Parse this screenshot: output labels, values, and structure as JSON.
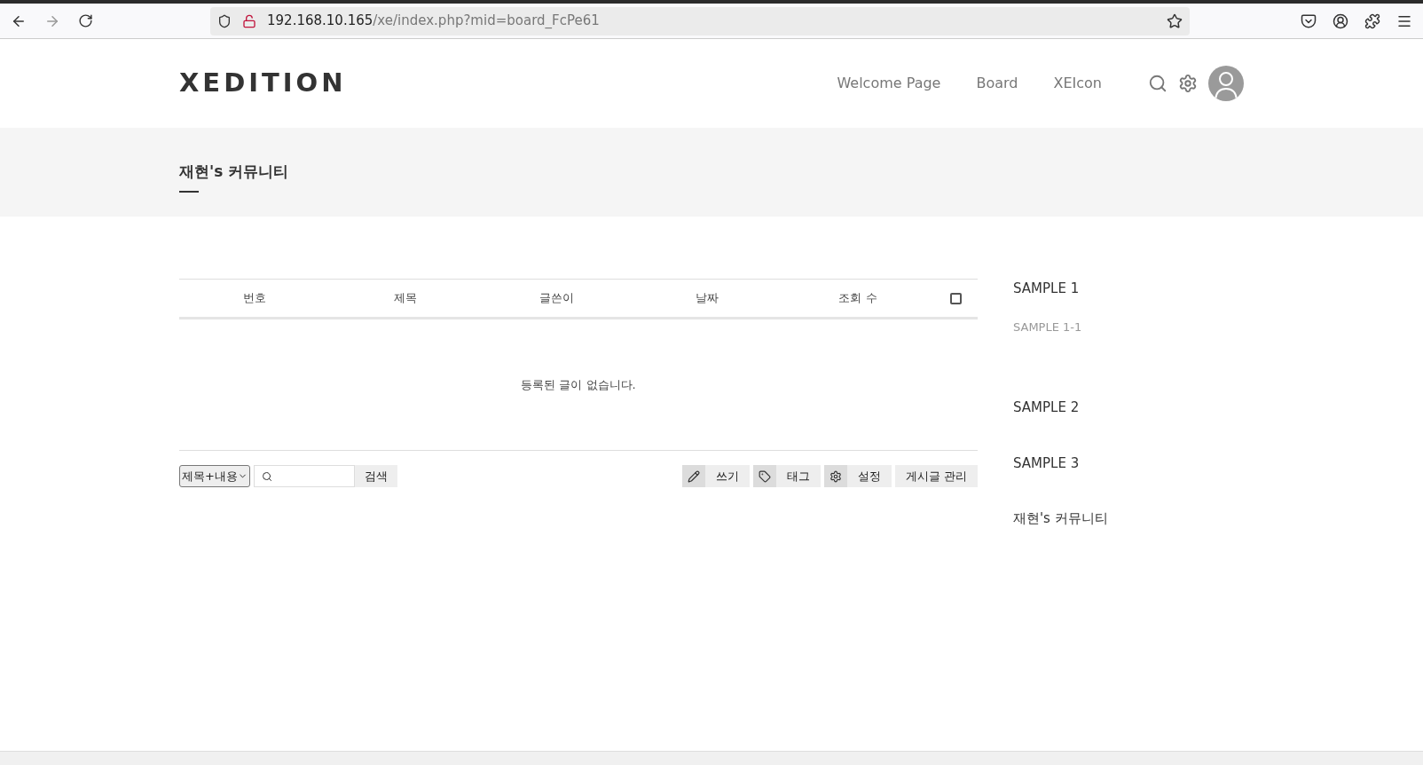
{
  "browser": {
    "url_host": "192.168.10.165",
    "url_path": "/xe/index.php?mid=board_FcPe61"
  },
  "site": {
    "logo": "XEDITION",
    "nav": [
      {
        "label": "Welcome Page"
      },
      {
        "label": "Board"
      },
      {
        "label": "XEIcon"
      }
    ]
  },
  "page_title": "재현's 커뮤니티",
  "table": {
    "columns": [
      "번호",
      "제목",
      "글쓴이",
      "날짜",
      "조회 수"
    ],
    "select_all_checked": false,
    "empty_message": "등록된 글이 없습니다."
  },
  "search": {
    "scope": "제목+내용",
    "button": "검색"
  },
  "actions": [
    {
      "kind": "write",
      "label": "쓰기"
    },
    {
      "kind": "tag",
      "label": "태그"
    },
    {
      "kind": "settings",
      "label": "설정"
    },
    {
      "kind": "manage",
      "label": "게시글 관리"
    }
  ],
  "sidebar": {
    "items": [
      {
        "label": "SAMPLE 1",
        "children": [
          {
            "label": "SAMPLE 1-1"
          }
        ]
      },
      {
        "label": "SAMPLE 2"
      },
      {
        "label": "SAMPLE 3"
      },
      {
        "label": "재현's 커뮤니티"
      }
    ]
  }
}
